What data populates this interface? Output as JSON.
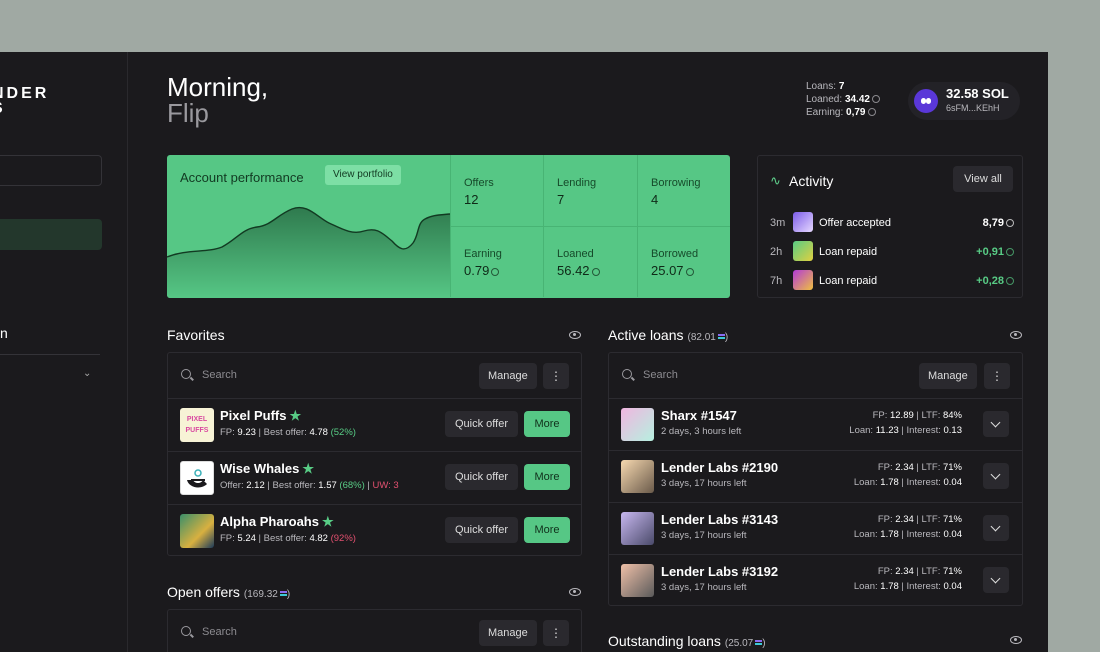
{
  "sidebar": {
    "logo_line1": "NDER",
    "logo_line2": "S",
    "partial_text": "n"
  },
  "header": {
    "greeting": "Morning,",
    "user": "Flip"
  },
  "stats": {
    "loans_label": "Loans:",
    "loans": "7",
    "loaned_label": "Loaned:",
    "loaned": "34.42",
    "earning_label": "Earning:",
    "earning": "0,79"
  },
  "wallet": {
    "balance": "32.58 SOL",
    "address": "6sFM...KEhH"
  },
  "performance": {
    "title": "Account performance",
    "button": "View portfolio",
    "cells": [
      {
        "label": "Offers",
        "value": "12"
      },
      {
        "label": "Lending",
        "value": "7"
      },
      {
        "label": "Borrowing",
        "value": "4"
      },
      {
        "label": "Earning",
        "value": "0.79"
      },
      {
        "label": "Loaned",
        "value": "56.42"
      },
      {
        "label": "Borrowed",
        "value": "25.07"
      }
    ]
  },
  "activity": {
    "title": "Activity",
    "view_all": "View all",
    "items": [
      {
        "time": "3m",
        "label": "Offer accepted",
        "amount": "8,79",
        "color": "#ffffff"
      },
      {
        "time": "2h",
        "label": "Loan repaid",
        "amount": "+0,91",
        "color": "#58cc85"
      },
      {
        "time": "7h",
        "label": "Loan repaid",
        "amount": "+0,28",
        "color": "#58cc85"
      }
    ]
  },
  "favorites": {
    "title": "Favorites",
    "search_placeholder": "Search",
    "manage": "Manage",
    "more_dots": "⋮",
    "items": [
      {
        "name": "Pixel Puffs",
        "fp_label": "FP:",
        "fp": "9.23",
        "best_label": "Best offer:",
        "best": "4.78",
        "pct": "(52%)",
        "extra": ""
      },
      {
        "name": "Wise Whales",
        "fp_label": "Offer:",
        "fp": "2.12",
        "best_label": "Best offer:",
        "best": "1.57",
        "pct": "(68%)",
        "extra": "UW: 3"
      },
      {
        "name": "Alpha Pharoahs",
        "fp_label": "FP:",
        "fp": "5.24",
        "best_label": "Best offer:",
        "best": "4.82",
        "pct": "(92%)",
        "extra": ""
      }
    ],
    "quick_offer": "Quick offer",
    "more": "More"
  },
  "active_loans": {
    "title": "Active loans",
    "total": "(82.01",
    "search_placeholder": "Search",
    "manage": "Manage",
    "more_dots": "⋮",
    "items": [
      {
        "name": "Sharx #1547",
        "time": "2 days, 3 hours left",
        "fp": "12.89",
        "ltf": "84%",
        "loan": "11.23",
        "interest": "0.13"
      },
      {
        "name": "Lender Labs #2190",
        "time": "3 days, 17 hours left",
        "fp": "2.34",
        "ltf": "71%",
        "loan": "1.78",
        "interest": "0.04"
      },
      {
        "name": "Lender Labs #3143",
        "time": "3 days, 17 hours left",
        "fp": "2.34",
        "ltf": "71%",
        "loan": "1.78",
        "interest": "0.04"
      },
      {
        "name": "Lender Labs #3192",
        "time": "3 days, 17 hours left",
        "fp": "2.34",
        "ltf": "71%",
        "loan": "1.78",
        "interest": "0.04"
      }
    ],
    "labels": {
      "fp": "FP:",
      "ltf": "LTF:",
      "loan": "Loan:",
      "interest": "Interest:",
      "sep": "|"
    }
  },
  "open_offers": {
    "title": "Open offers",
    "total": "(169.32",
    "search_placeholder": "Search",
    "manage": "Manage",
    "more_dots": "⋮"
  },
  "outstanding_loans": {
    "title": "Outstanding loans",
    "total": "(25.07"
  },
  "colors": {
    "accent": "#56c785",
    "background": "#1b1a1d",
    "negative": "#e2506f"
  }
}
